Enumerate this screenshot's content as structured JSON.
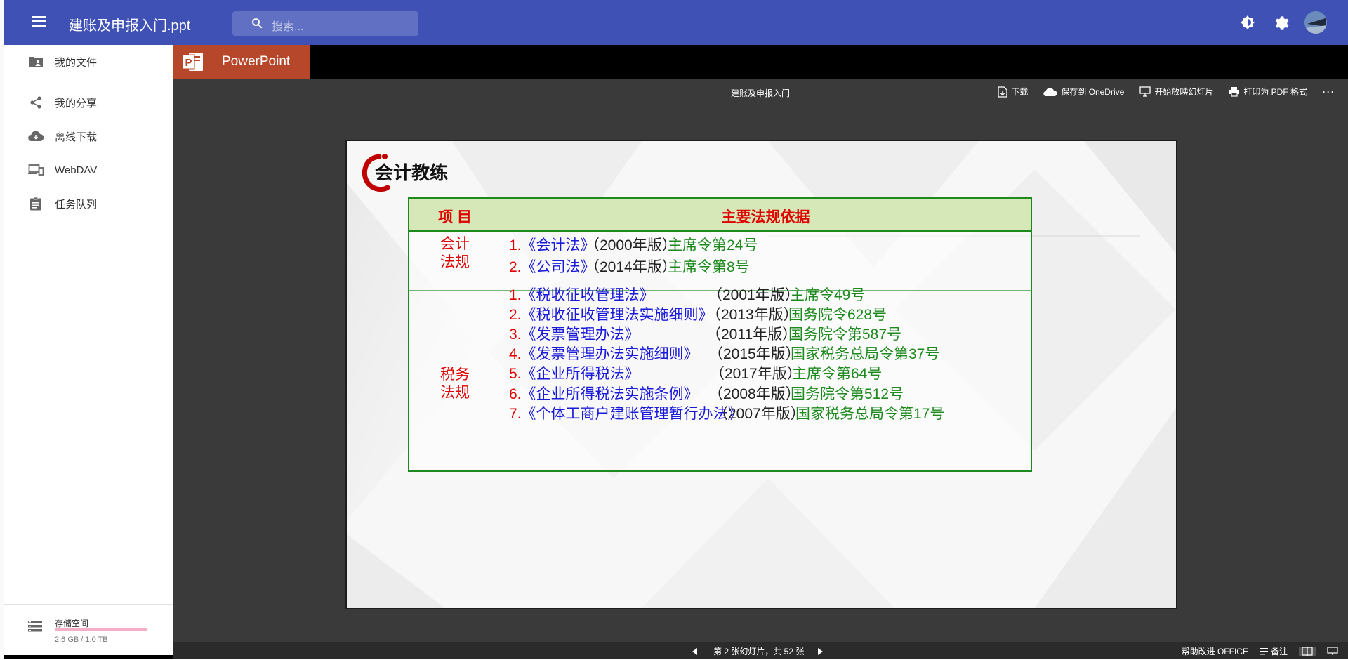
{
  "app": {
    "title": "建账及申报入门.ppt",
    "search_placeholder": "搜索..."
  },
  "sidebar": {
    "items": [
      {
        "label": "我的文件",
        "icon": "folder-account-icon"
      },
      {
        "label": "我的分享",
        "icon": "share-icon"
      },
      {
        "label": "离线下载",
        "icon": "cloud-download-icon"
      },
      {
        "label": "WebDAV",
        "icon": "devices-icon"
      },
      {
        "label": "任务队列",
        "icon": "clipboard-list-icon"
      }
    ],
    "storage": {
      "title": "存储空间",
      "usage": "2.6 GB / 1.0 TB",
      "used_fraction": 0.0025
    }
  },
  "viewer": {
    "app_name": "PowerPoint",
    "doc_title": "建账及申报入门",
    "actions": [
      "下载",
      "保存到 OneDrive",
      "开始放映幻灯片",
      "打印为 PDF 格式"
    ],
    "more": "···",
    "status": "第 2 张幻灯片，共 52 张",
    "help": "帮助改进 OFFICE",
    "notes": "备注"
  },
  "slide": {
    "logo_text": "会计教练",
    "header": {
      "col1": "项 目",
      "col2": "主要法规依据"
    },
    "groups": [
      {
        "category": [
          "会计",
          "法规"
        ],
        "laws": [
          {
            "num": "1.",
            "name": "《会计法》",
            "year": "（2000年版）",
            "order": "主席令第24号"
          },
          {
            "num": "2.",
            "name": "《公司法》",
            "year": "（2014年版）",
            "order": "主席令第8号"
          }
        ]
      },
      {
        "category": [
          "税务",
          "法规"
        ],
        "laws": [
          {
            "num": "1.",
            "name": "《税收征收管理法》",
            "year": "（2001年版）",
            "order": "主席令49号"
          },
          {
            "num": "2.",
            "name": "《税收征收管理法实施细则》",
            "year": "（2013年版）",
            "order": "国务院令628号"
          },
          {
            "num": "3.",
            "name": "《发票管理办法》",
            "year": "（2011年版）",
            "order": "国务院令第587号"
          },
          {
            "num": "4.",
            "name": "《发票管理办法实施细则》",
            "year": "（2015年版）",
            "order": "国家税务总局令第37号"
          },
          {
            "num": "5.",
            "name": "《企业所得税法》",
            "year": "（2017年版）",
            "order": "主席令第64号"
          },
          {
            "num": "6.",
            "name": "《企业所得税法实施条例》",
            "year": "（2008年版）",
            "order": "国务院令第512号"
          },
          {
            "num": "7.",
            "name": "《个体工商户建账管理暂行办法》",
            "year": "（2007年版）",
            "order": "国家税务总局令第17号"
          }
        ]
      }
    ]
  },
  "colors": {
    "appbar": "#3f51b5",
    "ppt_brand": "#b7472a",
    "storage_bar": "#e91e63",
    "law_red": "#e00000",
    "law_blue": "#1a1adb",
    "law_green": "#1e8a1e"
  }
}
